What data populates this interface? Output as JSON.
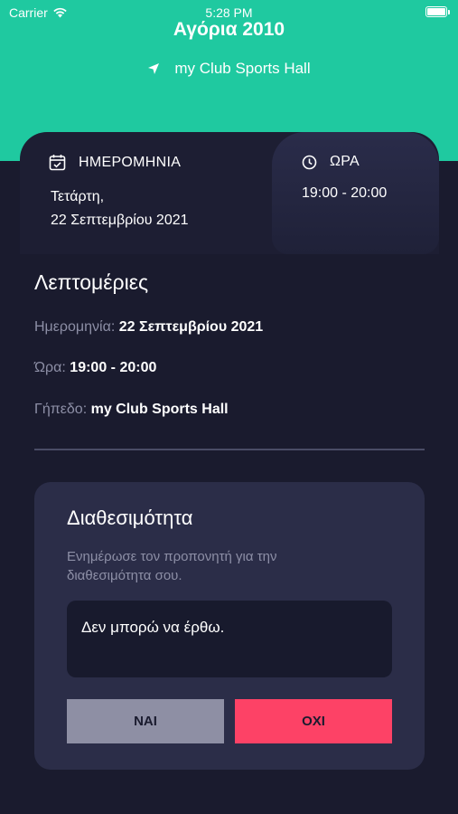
{
  "status_bar": {
    "carrier": "Carrier",
    "time": "5:28 PM"
  },
  "header": {
    "title": "Αγόρια 2010",
    "location": "my Club Sports Hall"
  },
  "info": {
    "date_label": "ΗΜΕΡΟΜΗΝΙΑ",
    "date_line1": "Τετάρτη,",
    "date_line2": "22 Σεπτεμβρίου 2021",
    "time_label": "ΩΡΑ",
    "time_value": "19:00 - 20:00"
  },
  "details": {
    "title": "Λεπτομέριες",
    "rows": [
      {
        "label": "Ημερομηνία:",
        "value": "22 Σεπτεμβρίου 2021"
      },
      {
        "label": "Ώρα:",
        "value": "19:00 - 20:00"
      },
      {
        "label": "Γήπεδο:",
        "value": "my Club Sports Hall"
      }
    ]
  },
  "availability": {
    "title": "Διαθεσιμότητα",
    "subtitle": "Ενημέρωσε τον προπονητή για την διαθεσιμότητα σου.",
    "message": "Δεν μπορώ να έρθω.",
    "yes_label": "ΝΑΙ",
    "no_label": "ΟΧΙ"
  },
  "colors": {
    "accent": "#1fc9a0",
    "background": "#1a1b2e",
    "no_button": "#fd4266",
    "yes_button": "#8e8fa4"
  }
}
